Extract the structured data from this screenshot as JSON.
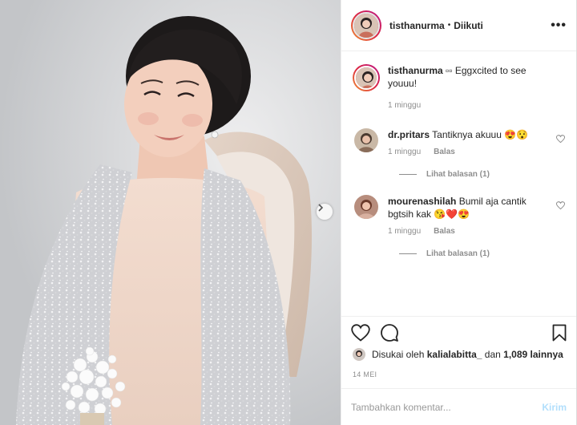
{
  "post": {
    "username": "tisthanurma",
    "separator": "•",
    "follow_status": "Diikuti",
    "more_icon": "more-options-icon",
    "caption": {
      "username": "tisthanurma",
      "text": "▫▫ Eggxcited to see youuu!",
      "time": "1 minggu"
    }
  },
  "comments": [
    {
      "username": "dr.pritars",
      "text": "Tantiknya akuuu 😍😯",
      "time": "1 minggu",
      "reply_label": "Balas",
      "view_replies": "Lihat balasan (1)"
    },
    {
      "username": "mourenashilah",
      "text": "Bumil aja cantik bgtsih kak 😘❤️😍",
      "time": "1 minggu",
      "reply_label": "Balas",
      "view_replies": "Lihat balasan (1)"
    }
  ],
  "likes": {
    "prefix": "Disukai oleh",
    "user": "kalialabitta_",
    "middle": "dan",
    "count": "1,089 lainnya"
  },
  "date": "14 MEI",
  "comment_input": {
    "placeholder": "Tambahkan komentar...",
    "post_label": "Kirim"
  },
  "colors": {
    "text": "#262626",
    "muted": "#8e8e8e",
    "post_disabled": "#b2dffc",
    "border": "#efefef"
  }
}
